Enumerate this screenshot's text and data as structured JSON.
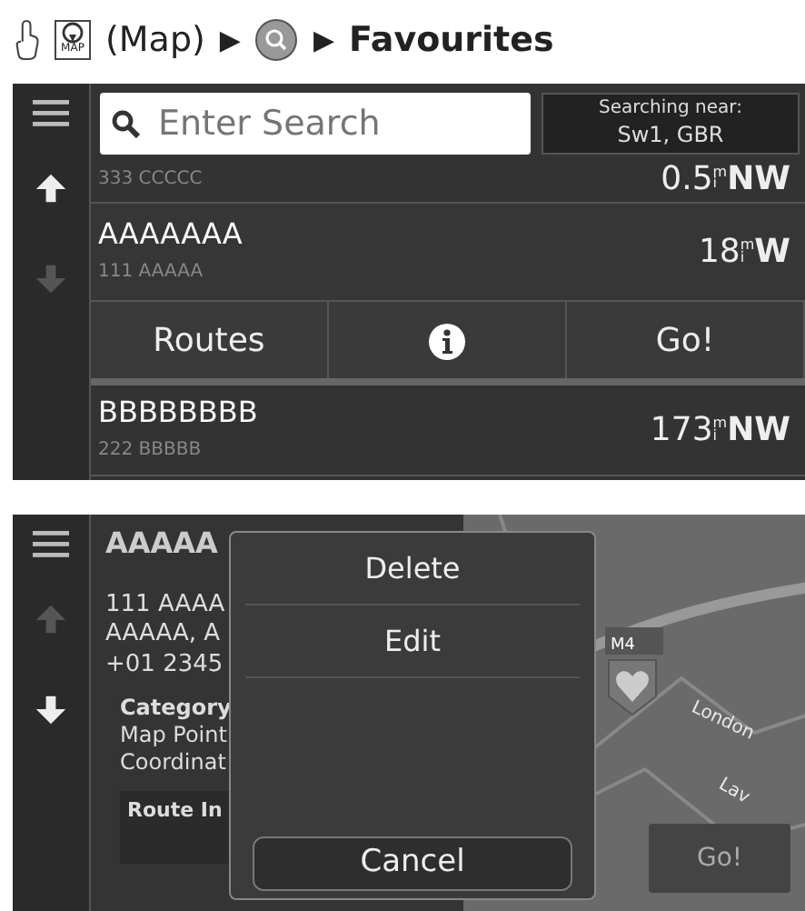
{
  "breadcrumb": {
    "map_icon_label": "MAP",
    "map_text": "(Map)",
    "separators": [
      "▶",
      "▶"
    ],
    "destination": "Favourites"
  },
  "search_screen": {
    "search": {
      "placeholder": "Enter Search"
    },
    "searching_near": {
      "label": "Searching near:",
      "value": "Sw1, GBR"
    },
    "results": [
      {
        "kind": "partial",
        "address": "333 CCCCC",
        "distance": "0.5",
        "unit": "mi",
        "direction": "NW"
      },
      {
        "kind": "full",
        "name": "AAAAAAA",
        "address": "111 AAAAA",
        "distance": "18",
        "unit": "mi",
        "direction": "W",
        "expanded": true
      },
      {
        "kind": "full",
        "name": "BBBBBBBB",
        "address": "222 BBBBB",
        "distance": "173",
        "unit": "mi",
        "direction": "NW",
        "expanded": false
      }
    ],
    "actions": [
      {
        "kind": "text",
        "label": "Routes"
      },
      {
        "kind": "info"
      },
      {
        "kind": "text",
        "label": "Go!"
      }
    ],
    "nav": [
      {
        "kind": "up",
        "disabled": false
      },
      {
        "kind": "down",
        "disabled": true
      }
    ]
  },
  "detail_screen": {
    "title": "AAAAA",
    "address_lines": [
      "111 AAAA",
      "AAAAA, A",
      "+01 2345"
    ],
    "category_label": "Category",
    "info_lines": [
      "Map Point",
      "Coordinat"
    ],
    "route_info_label": "Route In",
    "map_labels": [
      "London",
      "Lav"
    ],
    "road_sign": "M4",
    "go": "Go!",
    "nav": [
      {
        "kind": "up",
        "disabled": true
      },
      {
        "kind": "down",
        "disabled": false
      }
    ],
    "dialog": {
      "items": [
        "Delete",
        "Edit"
      ],
      "cancel": "Cancel"
    }
  }
}
